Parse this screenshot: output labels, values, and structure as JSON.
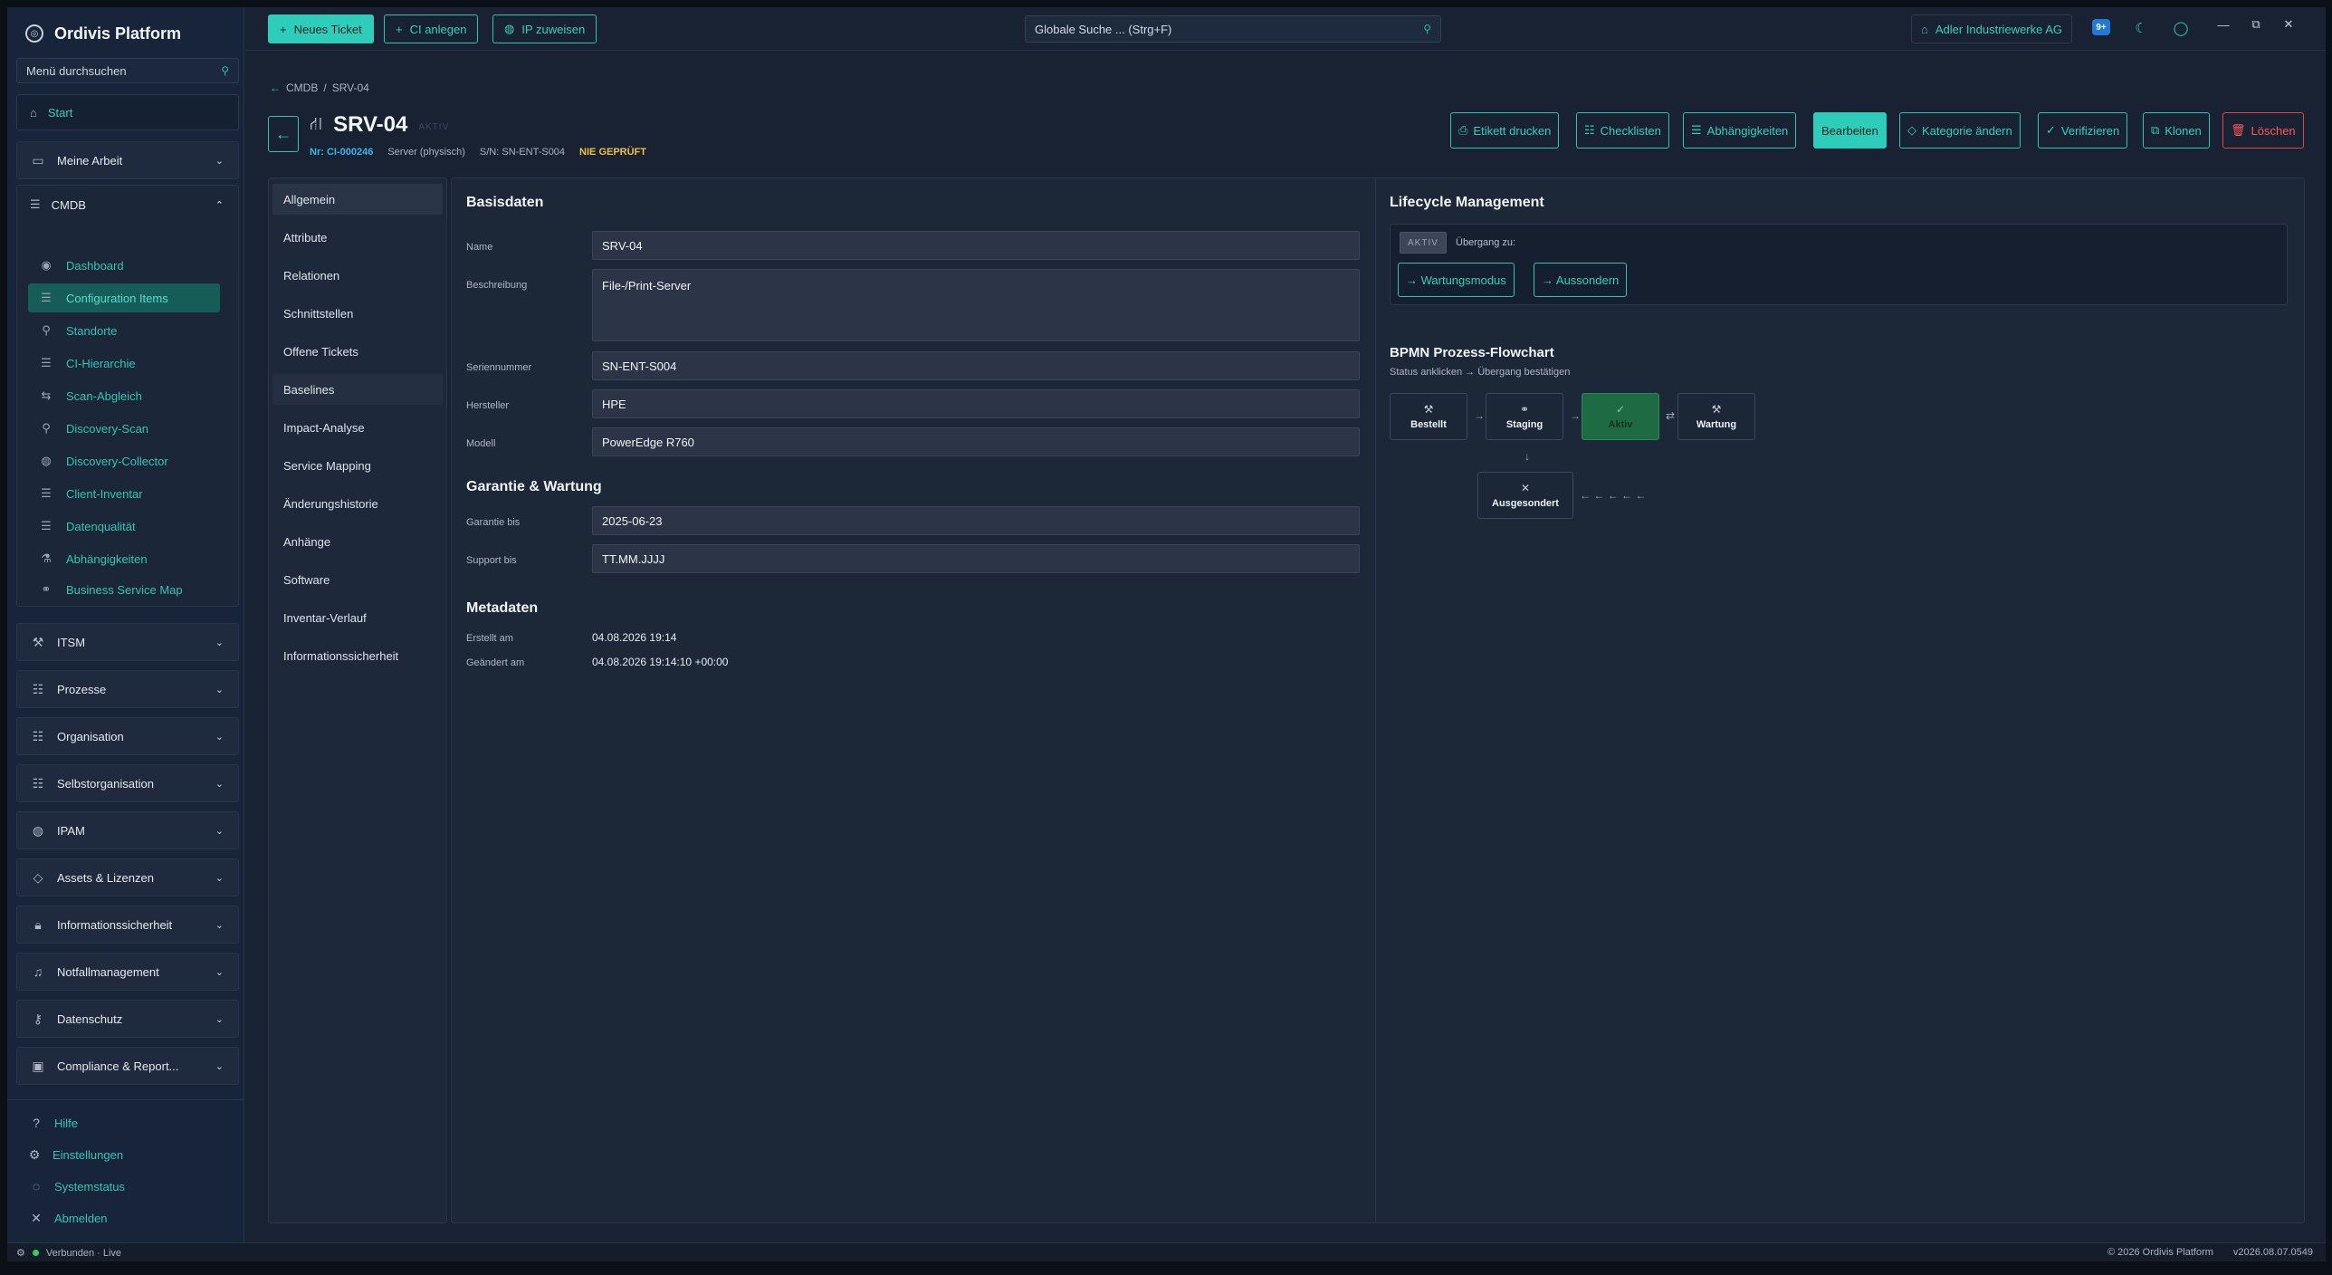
{
  "app": {
    "title": "Ordivis Platform"
  },
  "sidebar": {
    "search_placeholder": "Menü durchsuchen",
    "start": "Start",
    "groups": [
      {
        "label": "Meine Arbeit"
      },
      {
        "label": "CMDB"
      },
      {
        "label": "ITSM"
      },
      {
        "label": "Prozesse"
      },
      {
        "label": "Organisation"
      },
      {
        "label": "Selbstorganisation"
      },
      {
        "label": "IPAM"
      },
      {
        "label": "Assets & Lizenzen"
      },
      {
        "label": "Informationssicherheit"
      },
      {
        "label": "Notfallmanagement"
      },
      {
        "label": "Datenschutz"
      },
      {
        "label": "Compliance & Report..."
      }
    ],
    "cmdb_items": [
      {
        "label": "Dashboard",
        "icon": "eye-icon"
      },
      {
        "label": "Configuration Items",
        "icon": "list-icon"
      },
      {
        "label": "Standorte",
        "icon": "pin-icon"
      },
      {
        "label": "CI-Hierarchie",
        "icon": "hierarchy-icon"
      },
      {
        "label": "Scan-Abgleich",
        "icon": "compare-icon"
      },
      {
        "label": "Discovery-Scan",
        "icon": "search-icon"
      },
      {
        "label": "Discovery-Collector",
        "icon": "globe-icon"
      },
      {
        "label": "Client-Inventar",
        "icon": "list-icon"
      },
      {
        "label": "Datenqualität",
        "icon": "list-icon"
      },
      {
        "label": "Abhängigkeiten",
        "icon": "flask-icon"
      },
      {
        "label": "Business Service Map",
        "icon": "link-icon"
      }
    ],
    "footer": [
      {
        "label": "Hilfe",
        "icon": "help-icon"
      },
      {
        "label": "Einstellungen",
        "icon": "gear-icon"
      },
      {
        "label": "Systemstatus",
        "icon": "check-circle-icon"
      },
      {
        "label": "Abmelden",
        "icon": "close-icon"
      }
    ]
  },
  "topbar": {
    "new_ticket": "Neues Ticket",
    "ci_anlegen": "CI anlegen",
    "ip_zuweisen": "IP zuweisen",
    "search_placeholder": "Globale Suche ... (Strg+F)",
    "company": "Adler Industriewerke AG",
    "notification_badge": "9+"
  },
  "breadcrumb": {
    "root": "CMDB",
    "current": "SRV-04"
  },
  "ci": {
    "title": "SRV-04",
    "status_ghost": "AKTIV",
    "nr": "Nr: CI-000246",
    "type": "Server (physisch)",
    "serial": "S/N: SN-ENT-S004",
    "verify_status": "NIE GEPRÜFT"
  },
  "actions": {
    "etikett": "Etikett drucken",
    "checklisten": "Checklisten",
    "abhaengigkeiten": "Abhängigkeiten",
    "bearbeiten": "Bearbeiten",
    "kategorie": "Kategorie ändern",
    "verifizieren": "Verifizieren",
    "klonen": "Klonen",
    "loeschen": "Löschen"
  },
  "tabs": [
    "Allgemein",
    "Attribute",
    "Relationen",
    "Schnittstellen",
    "Offene Tickets",
    "Baselines",
    "Impact-Analyse",
    "Service Mapping",
    "Änderungshistorie",
    "Anhänge",
    "Software",
    "Inventar-Verlauf",
    "Informationssicherheit"
  ],
  "basisdaten": {
    "title": "Basisdaten",
    "name_label": "Name",
    "name": "SRV-04",
    "beschreibung_label": "Beschreibung",
    "beschreibung": "File-/Print-Server",
    "serien_label": "Seriennummer",
    "serien": "SN-ENT-S004",
    "hersteller_label": "Hersteller",
    "hersteller": "HPE",
    "modell_label": "Modell",
    "modell": "PowerEdge R760"
  },
  "garantie": {
    "title": "Garantie & Wartung",
    "garantie_label": "Garantie bis",
    "garantie": "2025-06-23",
    "support_label": "Support bis",
    "support_placeholder": "TT.MM.JJJJ"
  },
  "metadaten": {
    "title": "Metadaten",
    "erstellt_label": "Erstellt am",
    "erstellt": "04.08.2026 19:14",
    "geaendert_label": "Geändert am",
    "geaendert": "04.08.2026 19:14:10 +00:00"
  },
  "lifecycle": {
    "title": "Lifecycle Management",
    "badge": "AKTIV",
    "transition_label": "Übergang zu:",
    "btn_wartung": "→ Wartungsmodus",
    "btn_aussondern": "→ Aussondern"
  },
  "flowchart": {
    "title": "BPMN Prozess-Flowchart",
    "subtitle": "Status anklicken → Übergang bestätigen",
    "nodes": [
      "Bestellt",
      "Staging",
      "Aktiv",
      "Wartung",
      "Ausgesondert"
    ],
    "arrow_right": "→",
    "arrow_bidir": "⇄",
    "arrow_down": "↓",
    "return_arrows": "← ← ← ← ←"
  },
  "statusbar": {
    "connection": "Verbunden · Live",
    "copyright": "© 2026 Ordivis Platform",
    "version": "v2026.08.07.0549"
  },
  "colors": {
    "accent": "#2ecdb9",
    "danger": "#e04848",
    "warning": "#f0c040",
    "active_node": "#1e6a43"
  }
}
